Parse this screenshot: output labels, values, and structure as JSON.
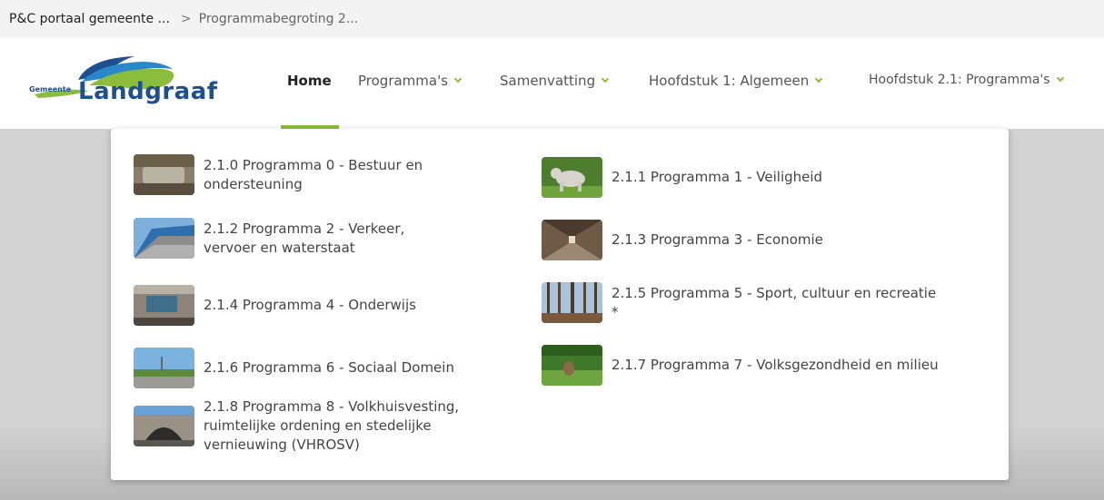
{
  "breadcrumb": {
    "root": "P&C portaal gemeente ...",
    "separator": ">",
    "current": "Programmabegroting 2..."
  },
  "logo": {
    "small_text": "Gemeente",
    "large_text": "Landgraaf"
  },
  "nav": {
    "items": [
      {
        "label": "Home",
        "active": true,
        "has_dropdown": false
      },
      {
        "label": "Programma's",
        "active": false,
        "has_dropdown": true
      },
      {
        "label": "Samenvatting",
        "active": false,
        "has_dropdown": true
      },
      {
        "label": "Hoofdstuk 1: Algemeen",
        "active": false,
        "has_dropdown": true
      },
      {
        "label": "Hoofdstuk 2.1: Programma's",
        "active": false,
        "has_dropdown": true
      }
    ]
  },
  "dropdown": {
    "items": [
      {
        "label": "2.1.0 Programma 0 - Bestuur en ondersteuning",
        "thumb": "bench-photo"
      },
      {
        "label": "2.1.1 Programma 1 - Veiligheid",
        "thumb": "dog-statue-photo"
      },
      {
        "label": "2.1.2 Programma 2 - Verkeer, vervoer en waterstaat",
        "thumb": "tunnel-road-photo"
      },
      {
        "label": "2.1.3 Programma 3 - Economie",
        "thumb": "shopping-arcade-photo"
      },
      {
        "label": "2.1.4 Programma 4 - Onderwijs",
        "thumb": "school-building-photo"
      },
      {
        "label": "2.1.5 Programma 5 - Sport, cultuur en recreatie *",
        "thumb": "forest-photo"
      },
      {
        "label": "2.1.6 Programma 6 - Sociaal Domein",
        "thumb": "park-square-photo"
      },
      {
        "label": "2.1.7 Programma 7 - Volksgezondheid en milieu",
        "thumb": "meadow-animal-photo"
      },
      {
        "label": "2.1.8 Programma 8 - Volkhuisvesting, ruimtelijke ordening en stedelijke vernieuwing (VHROSV)",
        "thumb": "bridge-tunnel-photo"
      }
    ]
  },
  "colors": {
    "accent": "#8bbd3c",
    "brand_blue": "#1e4f8f",
    "breadcrumb_bg": "#f3f3f3",
    "overlay": "#d2d2d2"
  }
}
